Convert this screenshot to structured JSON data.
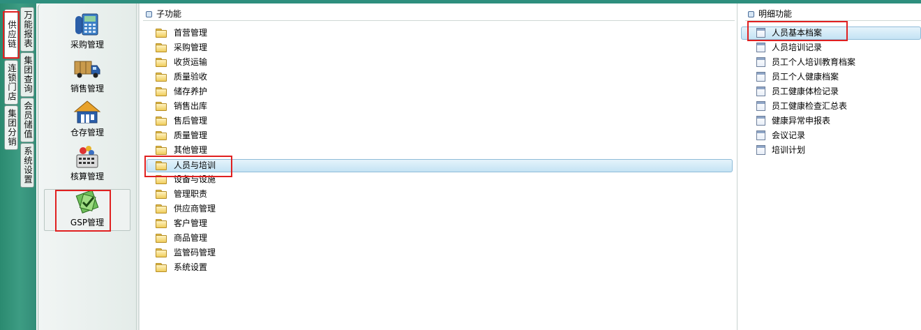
{
  "outer_tabs": [
    {
      "label": "供应链",
      "active": true
    },
    {
      "label": "连锁门店",
      "active": false
    },
    {
      "label": "集团分销",
      "active": false
    }
  ],
  "inner_tabs": [
    {
      "label": "万能报表"
    },
    {
      "label": "集团查询"
    },
    {
      "label": "会员储值"
    },
    {
      "label": "系统设置"
    }
  ],
  "modules": [
    {
      "label": "采购管理",
      "icon": "purchase-icon"
    },
    {
      "label": "销售管理",
      "icon": "truck-icon"
    },
    {
      "label": "仓存管理",
      "icon": "warehouse-icon"
    },
    {
      "label": "核算管理",
      "icon": "accounting-icon"
    },
    {
      "label": "GSP管理",
      "icon": "gsp-icon",
      "selected": true
    }
  ],
  "sub_panel": {
    "title": "子功能",
    "items": [
      "首营管理",
      "采购管理",
      "收货运输",
      "质量验收",
      "储存养护",
      "销售出库",
      "售后管理",
      "质量管理",
      "其他管理",
      "人员与培训",
      "设备与设施",
      "管理职责",
      "供应商管理",
      "客户管理",
      "商品管理",
      "监管码管理",
      "系统设置"
    ],
    "selected": "人员与培训"
  },
  "detail_panel": {
    "title": "明细功能",
    "items": [
      "人员基本档案",
      "人员培训记录",
      "员工个人培训教育档案",
      "员工个人健康档案",
      "员工健康体检记录",
      "员工健康检查汇总表",
      "健康异常申报表",
      "会议记录",
      "培训计划"
    ],
    "selected": "人员基本档案"
  },
  "colors": {
    "accent_green": "#2e8f7e",
    "highlight_red": "#e02020",
    "selection_blue": "#c4e3f4"
  }
}
